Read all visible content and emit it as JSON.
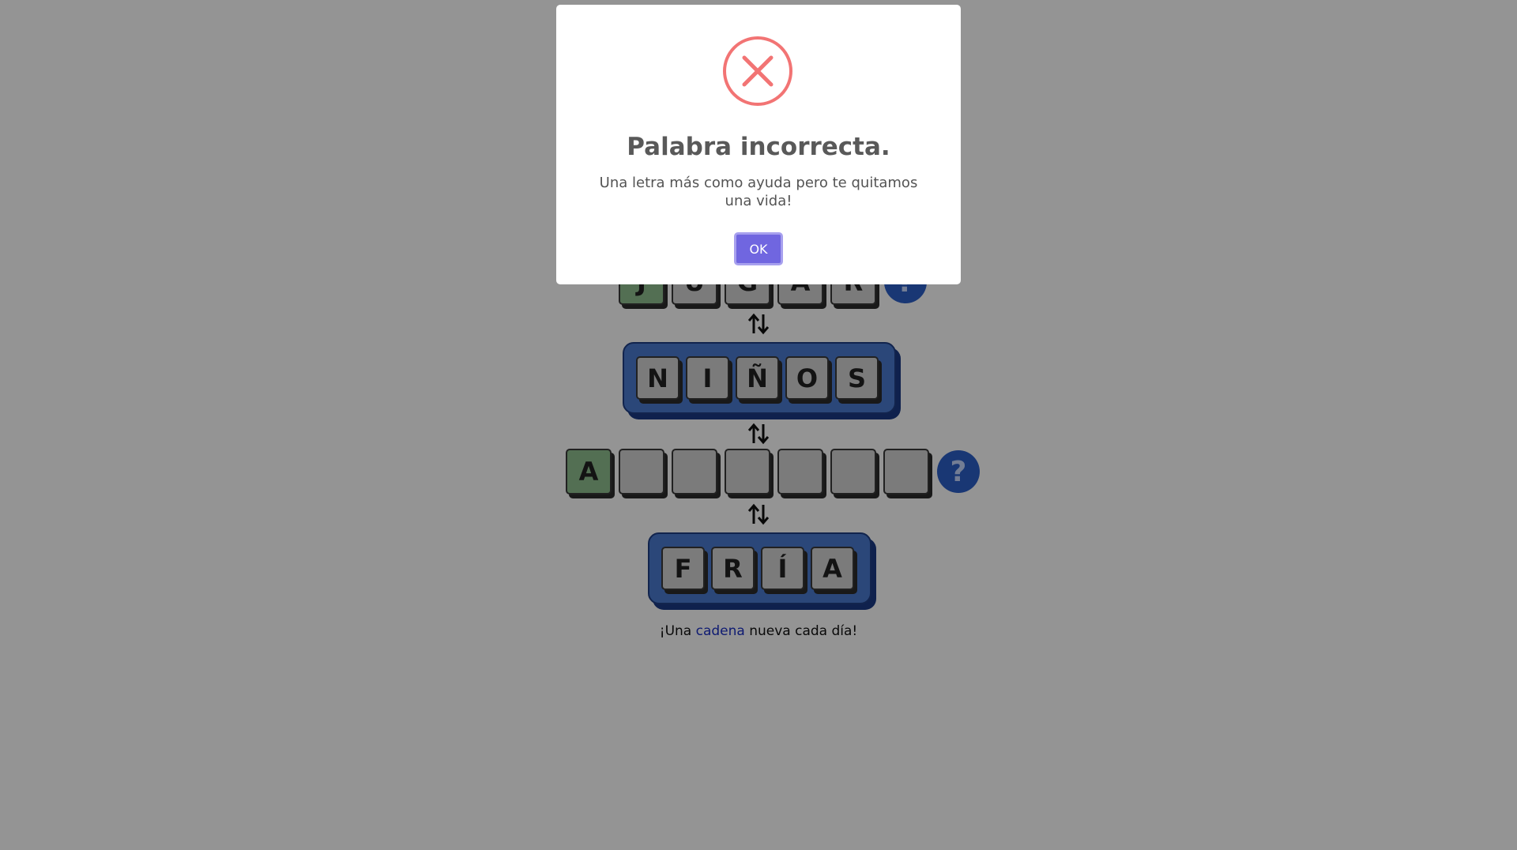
{
  "rows": {
    "row1": {
      "letters": [
        "J",
        "U",
        "G",
        "A",
        "R"
      ],
      "help_label": "?"
    },
    "row2": {
      "letters": [
        "N",
        "I",
        "Ñ",
        "O",
        "S"
      ]
    },
    "row3": {
      "letters": [
        "A",
        "",
        "",
        "",
        "",
        "",
        ""
      ],
      "help_label": "?"
    },
    "row4": {
      "letters": [
        "F",
        "R",
        "Í",
        "A"
      ]
    }
  },
  "tagline": {
    "prefix": "¡Una ",
    "link": "cadena",
    "suffix": " nueva cada día!"
  },
  "modal": {
    "title": "Palabra incorrecta.",
    "text": "Una letra más como ayuda pero te quitamos una vida!",
    "ok_label": "OK",
    "icon": "error-x-icon"
  },
  "colors": {
    "modal_icon": "#f27474",
    "ok_button": "#7066e0",
    "tile_green": "#8fc08f",
    "help_button": "#2c5fc9",
    "frame_blue": "#4a7bd1"
  }
}
